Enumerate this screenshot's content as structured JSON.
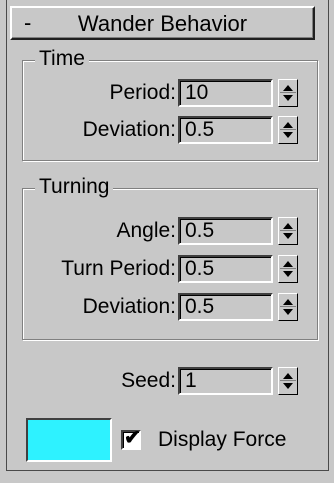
{
  "rollout": {
    "collapse_symbol": "-",
    "title": "Wander Behavior"
  },
  "time_group": {
    "label": "Time",
    "period": {
      "label": "Period:",
      "value": "10"
    },
    "deviation": {
      "label": "Deviation:",
      "value": "0.5"
    }
  },
  "turning_group": {
    "label": "Turning",
    "angle": {
      "label": "Angle:",
      "value": "0.5"
    },
    "turn_period": {
      "label": "Turn Period:",
      "value": "0.5"
    },
    "deviation": {
      "label": "Deviation:",
      "value": "0.5"
    }
  },
  "seed": {
    "label": "Seed:",
    "value": "1"
  },
  "display": {
    "swatch_color": "#2ef2ff",
    "checkmark": "✔",
    "checked": true,
    "label": "Display Force"
  }
}
